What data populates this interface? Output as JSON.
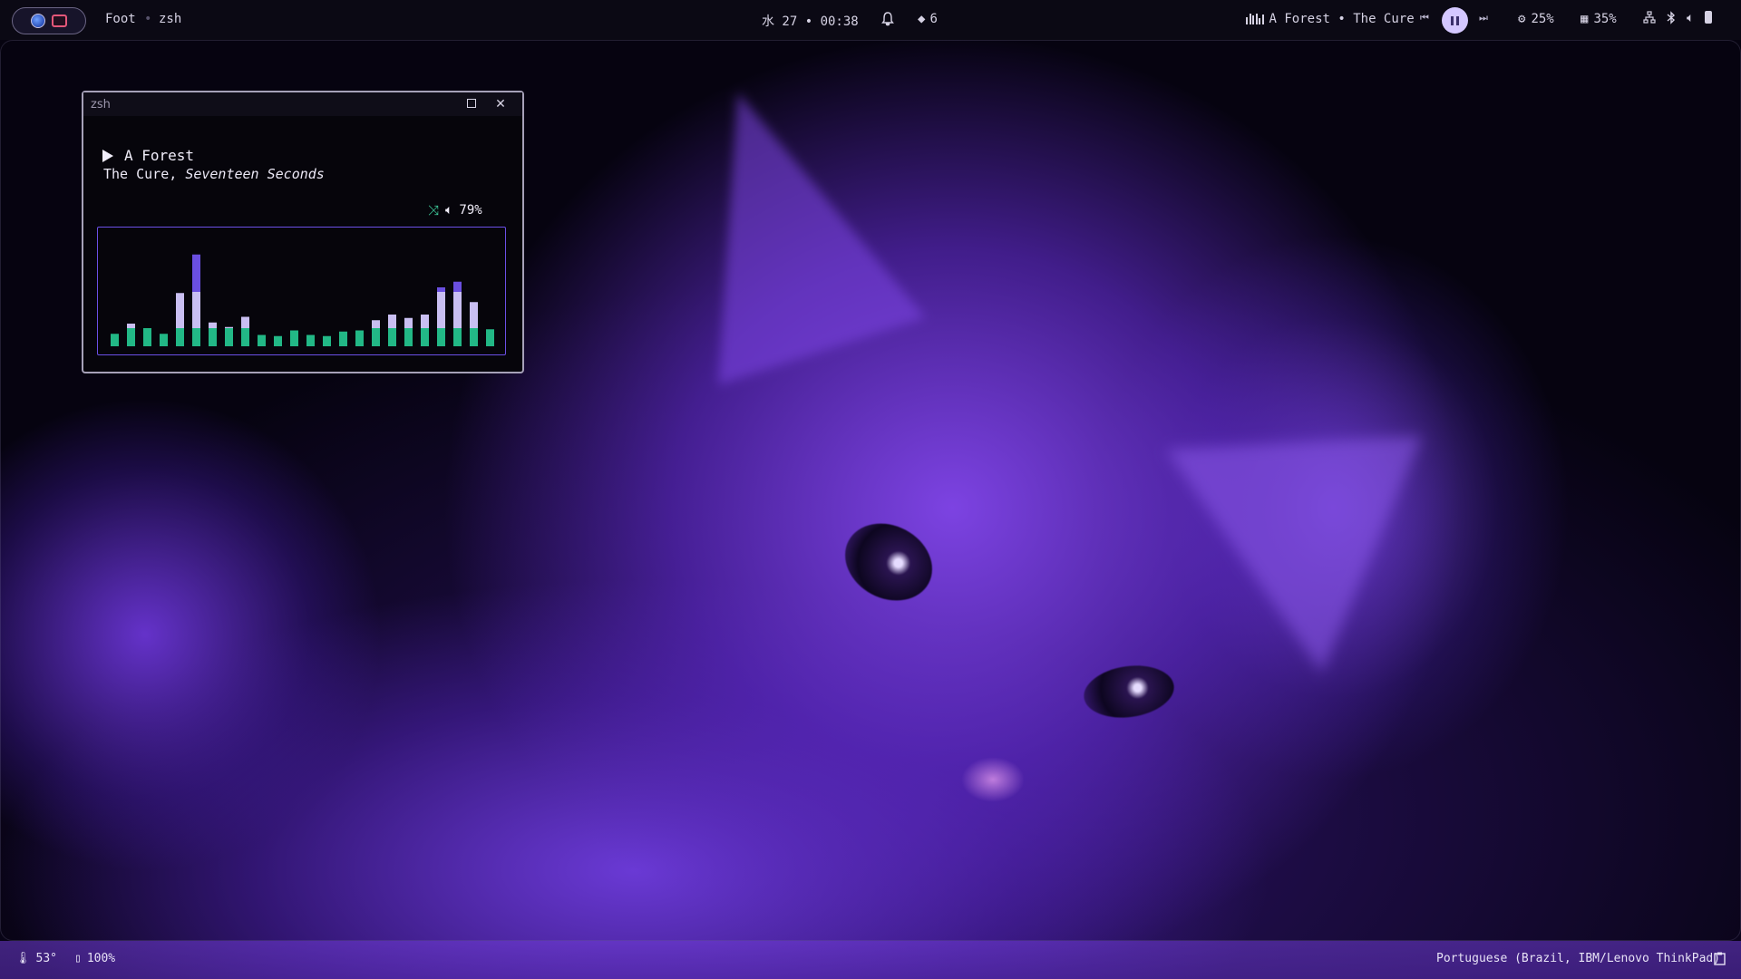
{
  "topbar": {
    "active_app": "Foot",
    "separator": "•",
    "window_title": "zsh",
    "clock": "水 27 • 00:38",
    "notifications_count": "6",
    "media": {
      "now_playing": "A Forest • The Cure"
    },
    "cpu": "25%",
    "memory": "35%"
  },
  "terminal": {
    "title": "zsh",
    "song": "A Forest",
    "artist": "The Cure,",
    "album": "Seventeen Seconds",
    "volume": "79%"
  },
  "visualizer": {
    "bar_color_low": "#22b886",
    "bar_color_mid": "#c9bff2",
    "bar_color_high": "#6a4fe0",
    "levels": [
      0.11,
      0.2,
      0.16,
      0.11,
      0.47,
      0.81,
      0.21,
      0.17,
      0.26,
      0.1,
      0.09,
      0.14,
      0.1,
      0.09,
      0.13,
      0.14,
      0.23,
      0.28,
      0.25,
      0.28,
      0.52,
      0.57,
      0.39,
      0.15
    ]
  },
  "bottombar": {
    "temperature": "53°",
    "brightness": "100%",
    "keyboard_layout": "Portuguese (Brazil, IBM/Lenovo ThinkPad)"
  },
  "colors": {
    "accent": "#6b4fe6",
    "green": "#22b886",
    "pause_button": "#d4c7ff"
  }
}
